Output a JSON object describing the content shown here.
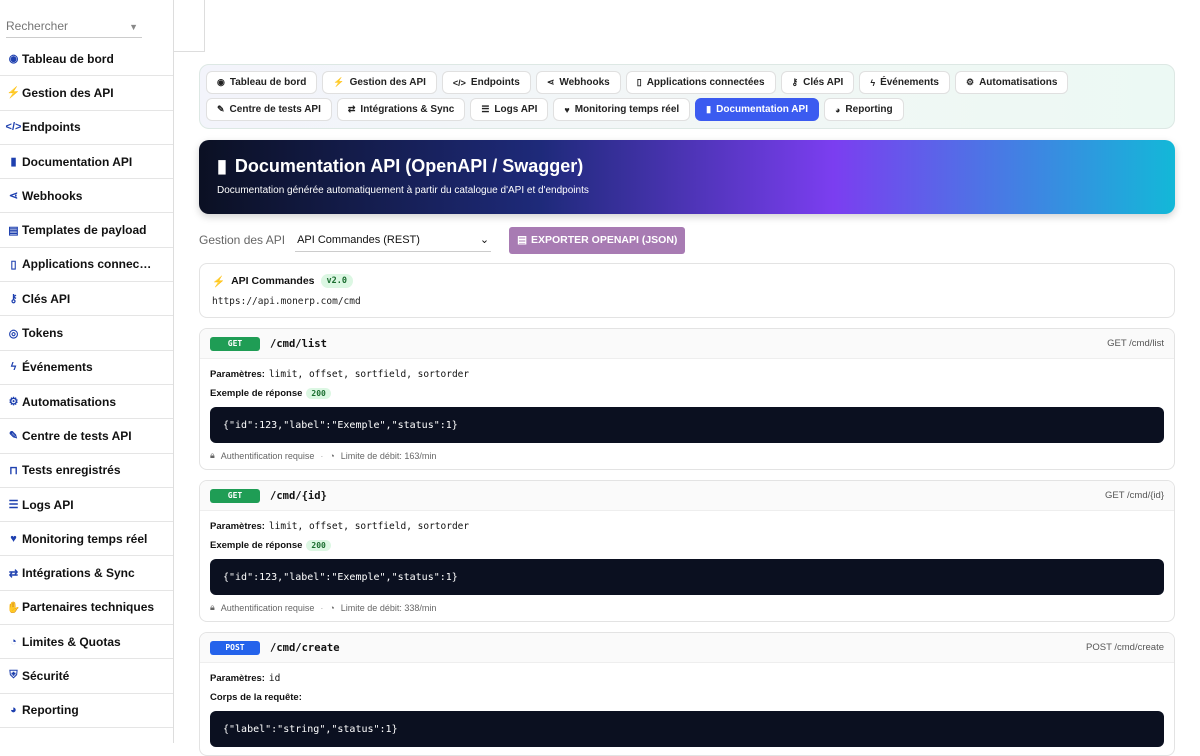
{
  "search": {
    "placeholder": "Rechercher"
  },
  "sidebar": {
    "items": [
      {
        "label": "Tableau de bord",
        "icon": "dashboard-icon",
        "glyph": "◉"
      },
      {
        "label": "Gestion des API",
        "icon": "plug-icon",
        "glyph": "⚡"
      },
      {
        "label": "Endpoints",
        "icon": "code-icon",
        "glyph": "</>"
      },
      {
        "label": "Documentation API",
        "icon": "book-icon",
        "glyph": "▮"
      },
      {
        "label": "Webhooks",
        "icon": "share-icon",
        "glyph": "⋖"
      },
      {
        "label": "Templates de payload",
        "icon": "file-code-icon",
        "glyph": "▤"
      },
      {
        "label": "Applications connec…",
        "icon": "mobile-icon",
        "glyph": "▯"
      },
      {
        "label": "Clés API",
        "icon": "key-icon",
        "glyph": "⚷"
      },
      {
        "label": "Tokens",
        "icon": "fingerprint-icon",
        "glyph": "◎"
      },
      {
        "label": "Événements",
        "icon": "bolt-icon",
        "glyph": "ϟ"
      },
      {
        "label": "Automatisations",
        "icon": "gears-icon",
        "glyph": "⚙"
      },
      {
        "label": "Centre de tests API",
        "icon": "pen-icon",
        "glyph": "✎"
      },
      {
        "label": "Tests enregistrés",
        "icon": "vials-icon",
        "glyph": "⊓"
      },
      {
        "label": "Logs API",
        "icon": "list-icon",
        "glyph": "☰"
      },
      {
        "label": "Monitoring temps réel",
        "icon": "heart-pulse-icon",
        "glyph": "♥"
      },
      {
        "label": "Intégrations & Sync",
        "icon": "arrows-icon",
        "glyph": "⇄"
      },
      {
        "label": "Partenaires techniques",
        "icon": "handshake-icon",
        "glyph": "✋"
      },
      {
        "label": "Limites & Quotas",
        "icon": "gauge-icon",
        "glyph": "◔"
      },
      {
        "label": "Sécurité",
        "icon": "shield-icon",
        "glyph": "⛨"
      },
      {
        "label": "Reporting",
        "icon": "chart-pie-icon",
        "glyph": "◕"
      }
    ]
  },
  "tabs": [
    {
      "label": "Tableau de bord",
      "glyph": "◉"
    },
    {
      "label": "Gestion des API",
      "glyph": "⚡"
    },
    {
      "label": "Endpoints",
      "glyph": "</>"
    },
    {
      "label": "Webhooks",
      "glyph": "⋖"
    },
    {
      "label": "Applications connectées",
      "glyph": "▯"
    },
    {
      "label": "Clés API",
      "glyph": "⚷"
    },
    {
      "label": "Événements",
      "glyph": "ϟ"
    },
    {
      "label": "Automatisations",
      "glyph": "⚙"
    },
    {
      "label": "Centre de tests API",
      "glyph": "✎"
    },
    {
      "label": "Intégrations & Sync",
      "glyph": "⇄"
    },
    {
      "label": "Logs API",
      "glyph": "☰"
    },
    {
      "label": "Monitoring temps réel",
      "glyph": "♥"
    },
    {
      "label": "Documentation API",
      "glyph": "▮",
      "active": true
    },
    {
      "label": "Reporting",
      "glyph": "◕"
    }
  ],
  "hero": {
    "title": "Documentation API (OpenAPI / Swagger)",
    "subtitle": "Documentation générée automatiquement à partir du catalogue d'API et d'endpoints"
  },
  "controls": {
    "label": "Gestion des API",
    "selected_api": "API Commandes (REST)",
    "export_label": "EXPORTER OPENAPI (JSON)"
  },
  "api": {
    "name": "API Commandes",
    "version": "v2.0",
    "base_url": "https://api.monerp.com/cmd"
  },
  "labels": {
    "params": "Paramètres:",
    "response_example": "Exemple de réponse",
    "request_body": "Corps de la requête:",
    "auth_required": "Authentification requise",
    "rate_limit_prefix": "Limite de débit:"
  },
  "endpoints": [
    {
      "method": "GET",
      "path": "/cmd/list",
      "summary": "GET /cmd/list",
      "params": "limit, offset, sortfield, sortorder",
      "status": "200",
      "code": "{\"id\":123,\"label\":\"Exemple\",\"status\":1}",
      "auth": "Authentification requise",
      "rate": "Limite de débit: 163/min"
    },
    {
      "method": "GET",
      "path": "/cmd/{id}",
      "summary": "GET /cmd/{id}",
      "params": "limit, offset, sortfield, sortorder",
      "status": "200",
      "code": "{\"id\":123,\"label\":\"Exemple\",\"status\":1}",
      "auth": "Authentification requise",
      "rate": "Limite de débit: 338/min"
    },
    {
      "method": "POST",
      "path": "/cmd/create",
      "summary": "POST /cmd/create",
      "params": "id",
      "code": "{\"label\":\"string\",\"status\":1}"
    }
  ],
  "colors": {
    "accent": "#3b5bf0",
    "get": "#1f9d55",
    "post": "#2563eb",
    "export_button": "#a87bb3",
    "code_bg": "#0b1020"
  }
}
